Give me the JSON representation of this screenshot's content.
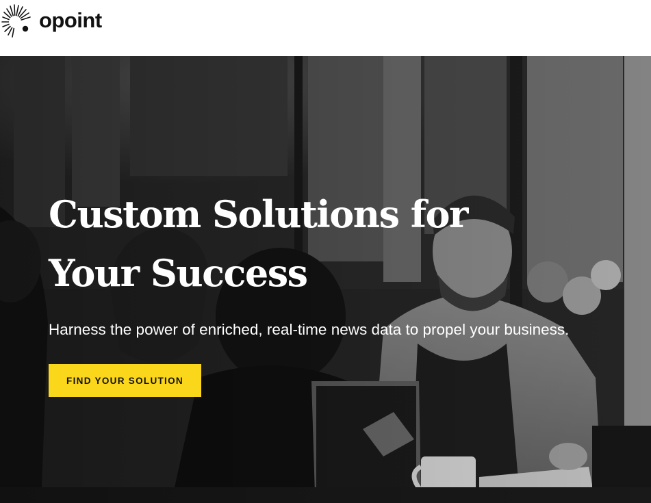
{
  "brand": {
    "name": "opoint",
    "logo_icon": "sunburst-dot-icon",
    "text_color": "#111111"
  },
  "hero": {
    "title": "Custom Solutions for Your Success",
    "subtitle": "Harness the power of enriched, real-time news data to propel your business.",
    "cta_label": "FIND YOUR SOLUTION",
    "cta_color": "#fbd71b",
    "background": "grayscale photo of people in a meeting"
  }
}
